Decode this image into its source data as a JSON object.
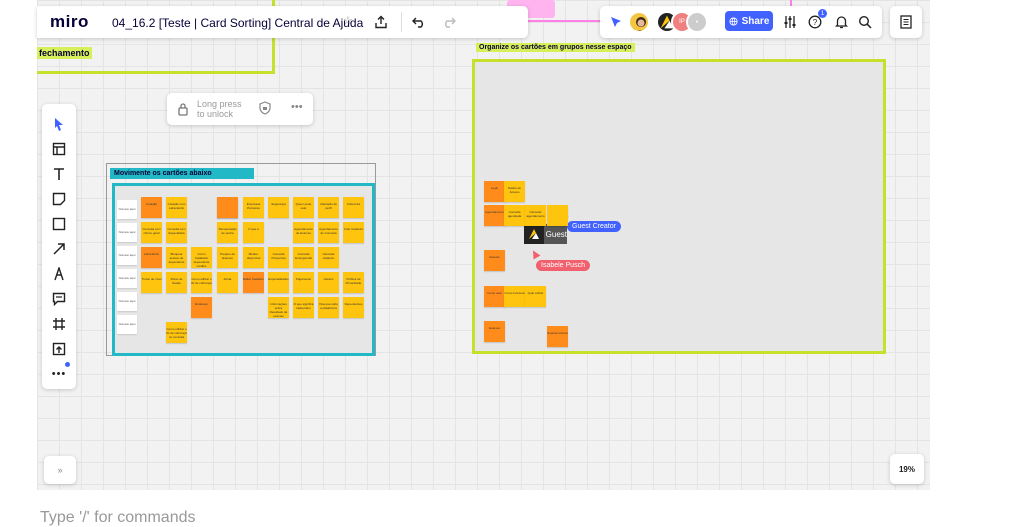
{
  "app": {
    "logo": "miro",
    "board_title": "04_16.2 [Teste | Card Sorting] Central de Ajuda"
  },
  "topbar": {
    "share_label": "Share",
    "notification_count": "1",
    "collaborator_initials": "IP"
  },
  "canvas": {
    "left_frame_label": "fechamento",
    "lock_text_line1": "Long press",
    "lock_text_line2": "to unlock",
    "cards_frame_title": "Movimente os cartões abaixo",
    "groups_frame_title": "Organize os cartões em grupos nesse espaço",
    "row_cards": [
      "Nomeie aqui",
      "Nomeie aqui",
      "Nomeie aqui",
      "Nomeie aqui",
      "Nomeie aqui",
      "Nomeie aqui"
    ],
    "cards": [
      "Cotação",
      "Cotação com Laboratório",
      "",
      "Busca",
      "Empresas Parceiras",
      "Segurança",
      "Quem pode usar",
      "Alteração de perfil",
      "Cobertura",
      "Consulta com clínico geral",
      "Consulta com Especialista",
      "",
      "Recuperação de senha",
      "O que é",
      "",
      "Agendamento de Exames",
      "Agendamento de Consulta",
      "Criar Cadastro",
      "Laboratório",
      "Bloquear acesso de dependente",
      "Como Cadastrar dependente médico",
      "Preparo de Exames",
      "Médico disponível",
      "Consulta Presencial",
      "Consulta Emergencial",
      "Cancelar cadastro",
      "",
      "Trocar de nível",
      "Plano de Saúde",
      "Como utilizar o ID de cobrança",
      "Ainda",
      "Editar Cadastro",
      "Especialidades",
      "Pagamento",
      "Horário",
      "Política de Privacidade",
      "",
      "",
      "Endereço",
      "",
      "",
      "Informações sobre Resultado de exames",
      "O que significa cada plano",
      "Viva que sofre a plataforma",
      "Dependentes",
      "",
      "Como utilizar o ID de cobrança no consulta"
    ],
    "group_cards": [
      "Login",
      "Dados de Acesso",
      "Agendamento",
      "Consulta agendada",
      "Cancelar agendamento",
      "Assunto",
      "Como usar",
      "Como funciona",
      "Qual cobrar",
      "Exames",
      "Suporte técnico"
    ],
    "guest_label": "Guest",
    "cursor_guest_creator": "Guest Creator",
    "cursor_isabele": "Isabele Pusch"
  },
  "bottom": {
    "zoom": "19%",
    "collapse_icon_text": "»",
    "command_placeholder": "Type '/' for commands"
  },
  "colors": {
    "accent": "#4262ff",
    "sticky_yellow": "#ffc40d",
    "sticky_orange": "#ff8c1a",
    "frame_green": "#c6e02b",
    "frame_teal": "#22b8c6",
    "cursor_pink": "#f0606d"
  }
}
